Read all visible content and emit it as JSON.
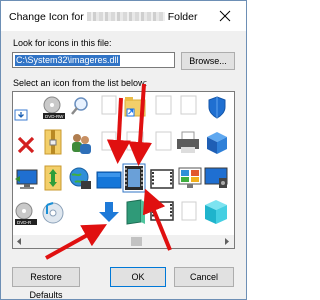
{
  "window": {
    "title_prefix": "Change Icon for",
    "title_suffix": "Folder"
  },
  "labels": {
    "look_for_icons": "Look for icons in this file:",
    "select_icon": "Select an icon from the list below:"
  },
  "path_input": {
    "value": "C:\\System32\\imageres.dll"
  },
  "buttons": {
    "browse": "Browse...",
    "restore_defaults": "Restore Defaults",
    "ok": "OK",
    "cancel": "Cancel"
  },
  "icons": {
    "row1": [
      "download-arrow-icon",
      "dvd-rw-drive-icon",
      "magnifier-icon",
      "blank-icon",
      "folder-shortcut-icon",
      "blank-icon",
      "blank-icon",
      "shield-icon"
    ],
    "row2": [
      "red-x-icon",
      "zip-folder-icon",
      "users-icon",
      "blank-icon",
      "blank-icon",
      "blank-icon",
      "printer-icon",
      "blue-cube-icon"
    ],
    "row3": [
      "monitor-icon",
      "updown-arrows-icon",
      "globe-network-icon",
      "blue-screen-icon",
      "film-strip-icon",
      "film-frame-icon",
      "media-display-icon",
      "monitor-speaker-icon"
    ],
    "row4": [
      "dvd-drive-icon",
      "music-disc-icon",
      "down-arrow-icon",
      "green-book-icon",
      "film-frame-icon",
      "blank-icon",
      "cyan-cube-icon",
      "blank-icon"
    ]
  },
  "colors": {
    "accent": "#0078d7",
    "selection": "#3174c6",
    "annotation_arrow": "#e01010"
  }
}
